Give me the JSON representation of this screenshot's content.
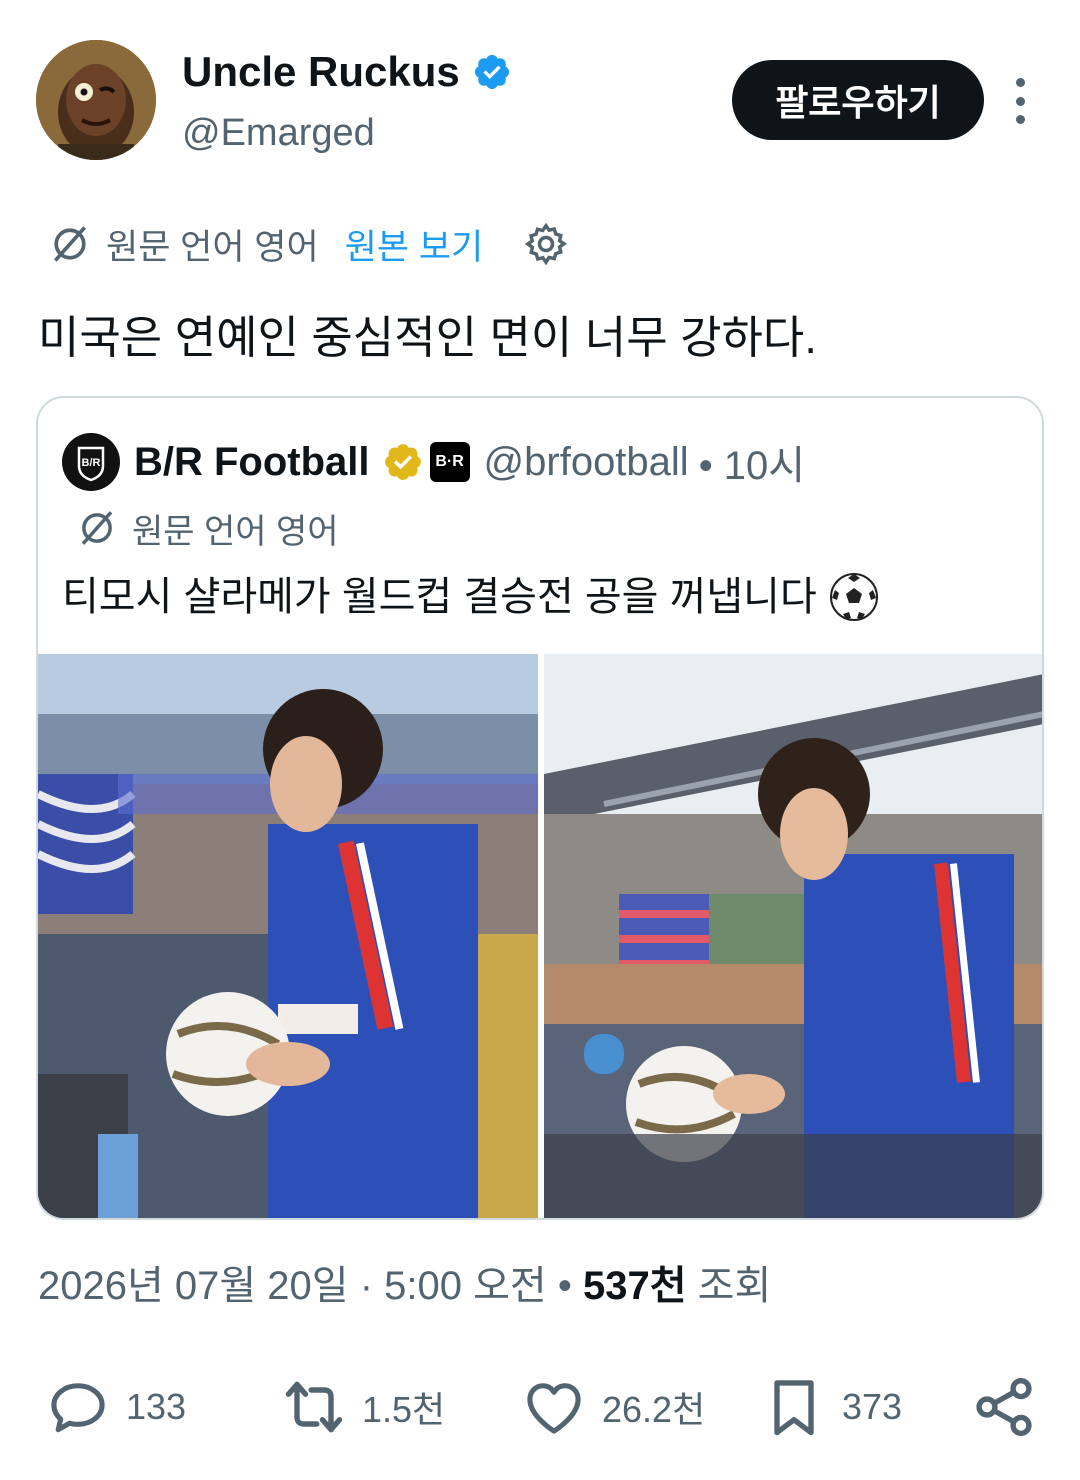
{
  "author": {
    "display_name": "Uncle Ruckus",
    "handle": "@Emarged",
    "follow_label": "팔로우하기"
  },
  "translation": {
    "notice": "원문 언어 영어",
    "view_original": "원본 보기"
  },
  "tweet": {
    "text": "미국은 연예인 중심적인 면이 너무 강하다."
  },
  "quote": {
    "display_name": "B/R Football",
    "affiliate_badge": "B·R",
    "handle": "@brfootball",
    "time": "• 10시",
    "translation_notice": "원문 언어 영어",
    "text": "티모시 샬라메가 월드컵 결승전 공을 꺼냅니다"
  },
  "meta": {
    "date": "2026년 07월 20일",
    "time": "· 5:00 오전",
    "separator": "•",
    "views_count": "537천",
    "views_label": "조회"
  },
  "actions": {
    "replies": "133",
    "reposts": "1.5천",
    "likes": "26.2천",
    "bookmarks": "373"
  },
  "colors": {
    "text_primary": "#0f1419",
    "text_secondary": "#536471",
    "link_blue": "#1d9bf0",
    "verified_blue": "#1d9bf0",
    "verified_gold": "#e2b719",
    "border": "#cfd9de"
  },
  "icons": [
    "translate-icon",
    "settings-gear-icon",
    "verified-badge-icon",
    "gold-verified-badge-icon",
    "soccer-ball-icon",
    "reply-icon",
    "repost-icon",
    "like-icon",
    "bookmark-icon",
    "share-icon",
    "more-options-icon"
  ]
}
